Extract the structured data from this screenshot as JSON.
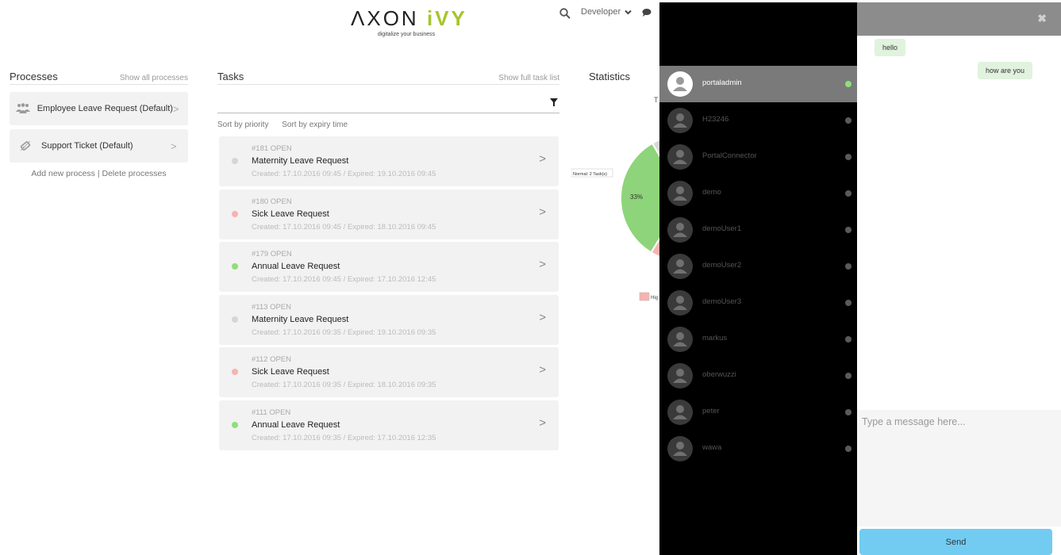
{
  "header": {
    "logo_main": "ΛXON ",
    "logo_accent": "iVY",
    "logo_tagline": "digitalize your business",
    "user_menu_label": "Developer",
    "icons": {
      "search": "search-icon",
      "user_menu": "chevron-down-icon",
      "chat": "chat-icon"
    }
  },
  "processes": {
    "title": "Processes",
    "show_all_label": "Show all processes",
    "items": [
      {
        "label": "Employee Leave Request (Default)",
        "icon": "group-icon"
      },
      {
        "label": "Support Ticket (Default)",
        "icon": "tag-icon"
      }
    ],
    "add_label": "Add new process",
    "separator": "|",
    "delete_label": "Delete processes"
  },
  "tasks": {
    "title": "Tasks",
    "show_full_label": "Show full task list",
    "sort_priority_label": "Sort by priority",
    "sort_expiry_label": "Sort by expiry time",
    "items": [
      {
        "id": "#181 OPEN",
        "name": "Maternity Leave Request",
        "dates": "Created: 17.10.2016 09:45 / Expired: 19.10.2016 09:45",
        "priority_color": "#d6d6d6"
      },
      {
        "id": "#180 OPEN",
        "name": "Sick Leave Request",
        "dates": "Created: 17.10.2016 09:45 / Expired: 18.10.2016 09:45",
        "priority_color": "#f7b3b0"
      },
      {
        "id": "#179 OPEN",
        "name": "Annual Leave Request",
        "dates": "Created: 17.10.2016 09:45 / Expired: 17.10.2016 12:45",
        "priority_color": "#8ee07a"
      },
      {
        "id": "#113 OPEN",
        "name": "Maternity Leave Request",
        "dates": "Created: 17.10.2016 09:35 / Expired: 19.10.2016 09:35",
        "priority_color": "#d6d6d6"
      },
      {
        "id": "#112 OPEN",
        "name": "Sick Leave Request",
        "dates": "Created: 17.10.2016 09:35 / Expired: 18.10.2016 09:35",
        "priority_color": "#f7b3b0"
      },
      {
        "id": "#111 OPEN",
        "name": "Annual Leave Request",
        "dates": "Created: 17.10.2016 09:35 / Expired: 17.10.2016 12:35",
        "priority_color": "#8ee07a"
      }
    ]
  },
  "statistics": {
    "title": "Statistics",
    "chart_data": {
      "type": "pie",
      "title": "T",
      "slices": [
        {
          "label": "Normal: 2 Task(s)",
          "value": 33,
          "display": "33%",
          "color": "#8ed47a"
        },
        {
          "label": "Hig",
          "color": "#f7b3b0"
        },
        {
          "label": "",
          "color": "#d8d8d8"
        }
      ]
    }
  },
  "chat": {
    "users": [
      {
        "name": "portaladmin",
        "active": true
      },
      {
        "name": "H23246",
        "active": false
      },
      {
        "name": "PortalConnector",
        "active": false
      },
      {
        "name": "demo",
        "active": false
      },
      {
        "name": "demoUser1",
        "active": false
      },
      {
        "name": "demoUser2",
        "active": false
      },
      {
        "name": "demoUser3",
        "active": false
      },
      {
        "name": "markus",
        "active": false
      },
      {
        "name": "oberwuzzi",
        "active": false
      },
      {
        "name": "peter",
        "active": false
      },
      {
        "name": "wawa",
        "active": false
      }
    ],
    "messages": [
      {
        "text": "hello",
        "side": "left"
      },
      {
        "text": "how are you",
        "side": "right"
      }
    ],
    "input_placeholder": "Type a message here...",
    "send_label": "Send",
    "close_icon": "close-icon",
    "colors": {
      "online": "#8ee07a",
      "offline": "#5a5a5a",
      "send": "#72ccf2",
      "bubble": "#e1f3de"
    }
  }
}
